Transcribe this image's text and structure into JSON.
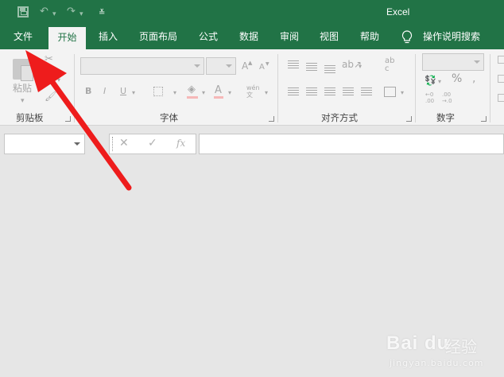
{
  "window": {
    "title": "Excel"
  },
  "quick_access": {
    "save_icon": "save-icon",
    "undo_icon": "undo-icon",
    "redo_icon": "redo-icon",
    "customize_icon": "customize-qat-icon"
  },
  "tabs": [
    {
      "label": "文件"
    },
    {
      "label": "开始",
      "active": true
    },
    {
      "label": "插入"
    },
    {
      "label": "页面布局"
    },
    {
      "label": "公式"
    },
    {
      "label": "数据"
    },
    {
      "label": "审阅"
    },
    {
      "label": "视图"
    },
    {
      "label": "帮助"
    },
    {
      "label": "操作说明搜索",
      "icon": "lightbulb-icon"
    }
  ],
  "ribbon": {
    "clipboard": {
      "label": "剪贴板",
      "paste_label": "粘贴"
    },
    "font": {
      "label": "字体",
      "bold": "B",
      "italic": "I",
      "underline": "U",
      "font_color": "A",
      "phonetic": "wén 文",
      "grow_font": "A",
      "shrink_font": "A"
    },
    "alignment": {
      "label": "对齐方式",
      "wrap_icon": "ab c"
    },
    "number": {
      "label": "数字",
      "percent": "%",
      "comma": ",",
      "inc_decimal": "←0 .00",
      "dec_decimal": ".00 →.0"
    }
  },
  "formula_bar": {
    "cancel": "✕",
    "confirm": "✓",
    "fx": "fx",
    "value": ""
  },
  "watermark": {
    "brand": "Bai du",
    "cn": "经验",
    "url": "jingyan.baidu.com"
  },
  "colors": {
    "accent": "#217346",
    "arrow": "#ee1c1c",
    "workspace": "#e6e6e6"
  }
}
